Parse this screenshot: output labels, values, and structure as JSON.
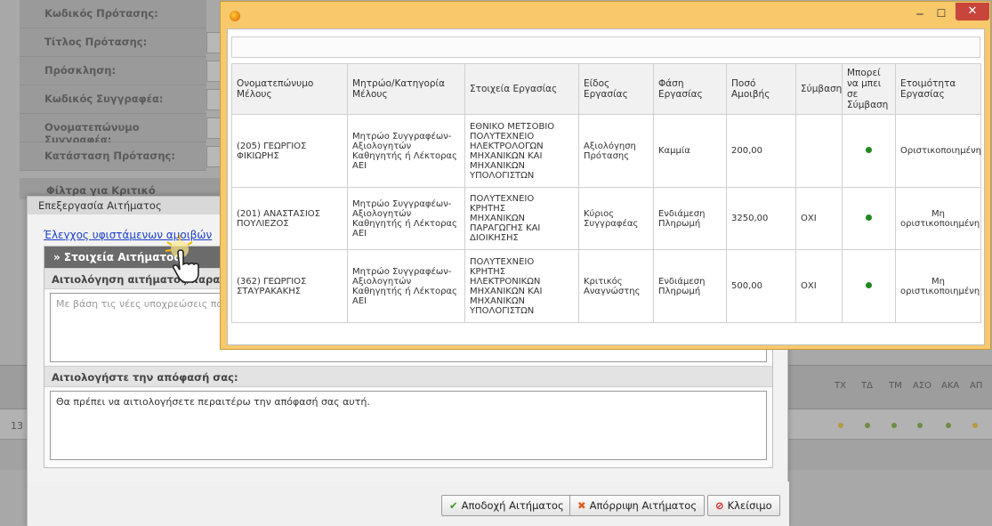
{
  "background_form": {
    "labels": [
      "Κωδικός Πρότασης:",
      "Τίτλος Πρότασης:",
      "Πρόσκληση:",
      "Κωδικός Συγγραφέα:",
      "Ονοματεπώνυμο Συγγραφέα:",
      "Κατάσταση Πρότασης:"
    ],
    "filters_title": "Φίλτρα για Κριτικό Αναγνώστη",
    "grid_columns": [
      "ΤΧ",
      "ΤΔ",
      "ΤΜ",
      "ΑΣΟ",
      "ΑΚΑ",
      "ΑΠ"
    ],
    "row_number": "13"
  },
  "dialog": {
    "title": "Επεξεργασία Αιτήματος",
    "link": "Έλεγχος υφιστάμενων αμοιβών",
    "panel_title": "» Στοιχεία Αιτήματος",
    "reason_label": "Αιτιολόγηση αιτήματος/παραίτησης",
    "reason_text": "Με βάση τις νέες υποχρεώσεις που αναλαμβάνω",
    "decision_label": "Αιτιολογήστε την απόφασή σας:",
    "decision_text": "Θα πρέπει να αιτιολογήσετε περαιτέρω την απόφασή σας αυτή.",
    "buttons": {
      "accept": "Αποδοχή Αιτήματος",
      "reject": "Απόρριψη Αιτήματος",
      "close": "Κλείσιμο"
    }
  },
  "popup": {
    "columns": [
      "Ονοματεπώνυμο Μέλους",
      "Μητρώο/Κατηγορία Μέλους",
      "Στοιχεία Εργασίας",
      "Είδος Εργασίας",
      "Φάση Εργασίας",
      "Ποσό Αμοιβής",
      "Σύμβαση",
      "Μπορεί να μπει σε Σύμβαση",
      "Ετοιμότητα Εργασίας"
    ],
    "rows": [
      {
        "member": "(205) ΓΕΩΡΓΙΟΣ\nΦΙΚΙΩΡΗΣ",
        "registry": "Μητρώο Συγγραφέων-\nΑξιολογητών\nΚαθηγητής ή Λέκτορας ΑΕΙ",
        "work": "ΕΘΝΙΚΟ ΜΕΤΣΟΒΙΟ\nΠΟΛΥΤΕΧΝΕΙΟ\nΗΛΕΚΤΡΟΛΟΓΩΝ\nΜΗΧΑΝΙΚΩΝ ΚΑΙ\nΜΗΧΑΝΙΚΩΝ\nΥΠΟΛΟΓΙΣΤΩΝ",
        "type": "Αξιολόγηση\nΠρότασης",
        "phase": "Καμμία",
        "amount": "200,00",
        "contract": "",
        "readiness": "Οριστικοποιημένη"
      },
      {
        "member": "(201) ΑΝΑΣΤΑΣΙΟΣ\nΠΟΥΛΙΕΖΟΣ",
        "registry": "Μητρώο Συγγραφέων-\nΑξιολογητών\nΚαθηγητής ή Λέκτορας ΑΕΙ",
        "work": "ΠΟΛΥΤΕΧΝΕΙΟ\nΚΡΗΤΗΣ\nΜΗΧΑΝΙΚΩΝ\nΠΑΡΑΓΩΓΗΣ ΚΑΙ\nΔΙΟΙΚΗΣΗΣ",
        "type": "Κύριος\nΣυγγραφέας",
        "phase": "Ενδιάμεση\nΠληρωμή",
        "amount": "3250,00",
        "contract": "ΟΧΙ",
        "readiness": "Μη\nοριστικοποιημένη"
      },
      {
        "member": "(362) ΓΕΩΡΓΙΟΣ\nΣΤΑΥΡΑΚΑΚΗΣ",
        "registry": "Μητρώο Συγγραφέων-\nΑξιολογητών\nΚαθηγητής ή Λέκτορας ΑΕΙ",
        "work": "ΠΟΛΥΤΕΧΝΕΙΟ\nΚΡΗΤΗΣ\nΗΛΕΚΤΡΟΝΙΚΩΝ\nΜΗΧΑΝΙΚΩΝ ΚΑΙ\nΜΗΧΑΝΙΚΩΝ\nΥΠΟΛΟΓΙΣΤΩΝ",
        "type": "Κριτικός\nΑναγνώστης",
        "phase": "Ενδιάμεση\nΠληρωμή",
        "amount": "500,00",
        "contract": "ΟΧΙ",
        "readiness": "Μη\nοριστικοποιημένη"
      }
    ]
  }
}
